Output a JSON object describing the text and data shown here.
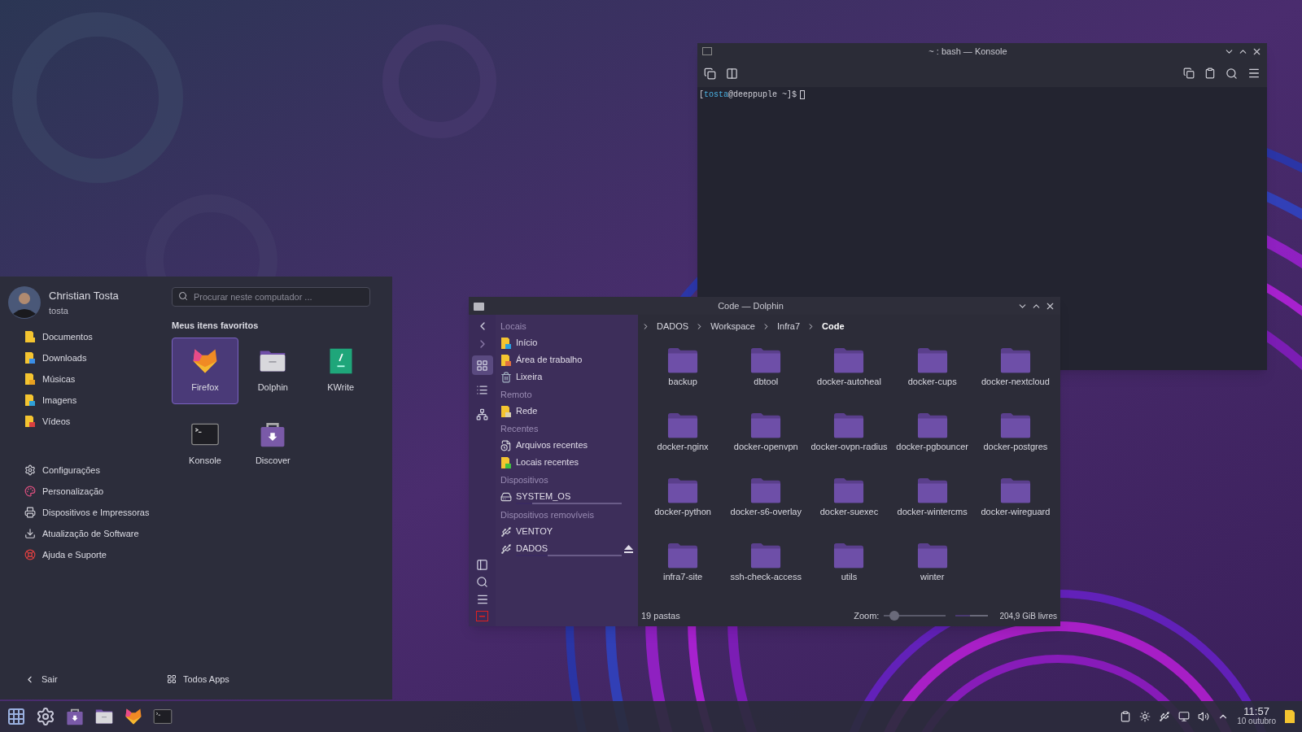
{
  "launcher": {
    "user": {
      "name": "Christian Tosta",
      "login": "tosta"
    },
    "search": {
      "placeholder": "Procurar neste computador ..."
    },
    "places": [
      {
        "label": "Documentos",
        "kind": "documents"
      },
      {
        "label": "Downloads",
        "kind": "downloads"
      },
      {
        "label": "Músicas",
        "kind": "music"
      },
      {
        "label": "Imagens",
        "kind": "pictures"
      },
      {
        "label": "Vídeos",
        "kind": "videos"
      }
    ],
    "system": [
      {
        "label": "Configurações",
        "kind": "settings"
      },
      {
        "label": "Personalização",
        "kind": "appearance"
      },
      {
        "label": "Dispositivos e Impressoras",
        "kind": "printer"
      },
      {
        "label": "Atualização de Software",
        "kind": "update"
      },
      {
        "label": "Ajuda e Suporte",
        "kind": "help"
      }
    ],
    "favorites_title": "Meus itens favoritos",
    "favorites": [
      {
        "label": "Firefox",
        "kind": "firefox",
        "selected": true
      },
      {
        "label": "Dolphin",
        "kind": "dolphin",
        "selected": false
      },
      {
        "label": "KWrite",
        "kind": "kwrite",
        "selected": false
      },
      {
        "label": "Konsole",
        "kind": "konsole",
        "selected": false
      },
      {
        "label": "Discover",
        "kind": "discover",
        "selected": false
      }
    ],
    "leave": "Sair",
    "all_apps": "Todos Apps"
  },
  "konsole": {
    "title": "~ : bash — Konsole",
    "prompt_open": "[",
    "prompt_user": "tosta",
    "prompt_rest": "@deeppuple ~]$"
  },
  "dolphin": {
    "title": "Code — Dolphin",
    "view_modes": [
      {
        "kind": "icons",
        "selected": true
      },
      {
        "kind": "compact",
        "selected": false
      },
      {
        "kind": "details",
        "selected": false
      }
    ],
    "sidebar": [
      {
        "heading": "Locais",
        "items": [
          {
            "label": "Início",
            "kind": "home"
          },
          {
            "label": "Área de trabalho",
            "kind": "desktop"
          },
          {
            "label": "Lixeira",
            "kind": "trash"
          }
        ]
      },
      {
        "heading": "Remoto",
        "items": [
          {
            "label": "Rede",
            "kind": "network"
          }
        ]
      },
      {
        "heading": "Recentes",
        "items": [
          {
            "label": "Arquivos recentes",
            "kind": "recent-files"
          },
          {
            "label": "Locais recentes",
            "kind": "recent-places"
          }
        ]
      },
      {
        "heading": "Dispositivos",
        "items": [
          {
            "label": "SYSTEM_OS",
            "kind": "drive",
            "level": 0.15
          }
        ]
      },
      {
        "heading": "Dispositivos removíveis",
        "items": [
          {
            "label": "VENTOY",
            "kind": "usb"
          },
          {
            "label": "DADOS",
            "kind": "usb",
            "level": 0.3,
            "ejectable": true
          }
        ]
      }
    ],
    "breadcrumb": [
      {
        "label": "DADOS",
        "selected": false
      },
      {
        "label": "Workspace",
        "selected": false
      },
      {
        "label": "Infra7",
        "selected": false
      },
      {
        "label": "Code",
        "selected": true
      }
    ],
    "folders": [
      "backup",
      "dbtool",
      "docker-autoheal",
      "docker-cups",
      "docker-nextcloud",
      "docker-nginx",
      "docker-openvpn",
      "docker-ovpn-radius",
      "docker-pgbouncer",
      "docker-postgres",
      "docker-python",
      "docker-s6-overlay",
      "docker-suexec",
      "docker-wintercms",
      "docker-wireguard",
      "infra7-site",
      "ssh-check-access",
      "utils",
      "winter"
    ],
    "status": "19 pastas",
    "zoom_label": "Zoom:",
    "zoom": {
      "level": 0.1
    },
    "free_space": {
      "label": "204,9 GiB livres",
      "level": 0.45
    }
  },
  "taskbar": {
    "apps": [
      {
        "kind": "launcher"
      },
      {
        "kind": "settings"
      },
      {
        "kind": "discover"
      },
      {
        "kind": "dolphin"
      },
      {
        "kind": "firefox"
      },
      {
        "kind": "konsole"
      }
    ],
    "tray": [
      {
        "kind": "clipboard"
      },
      {
        "kind": "brightness"
      },
      {
        "kind": "usb"
      },
      {
        "kind": "display"
      },
      {
        "kind": "volume"
      },
      {
        "kind": "expand"
      }
    ],
    "time": "11:57",
    "date": "10 outubro"
  }
}
